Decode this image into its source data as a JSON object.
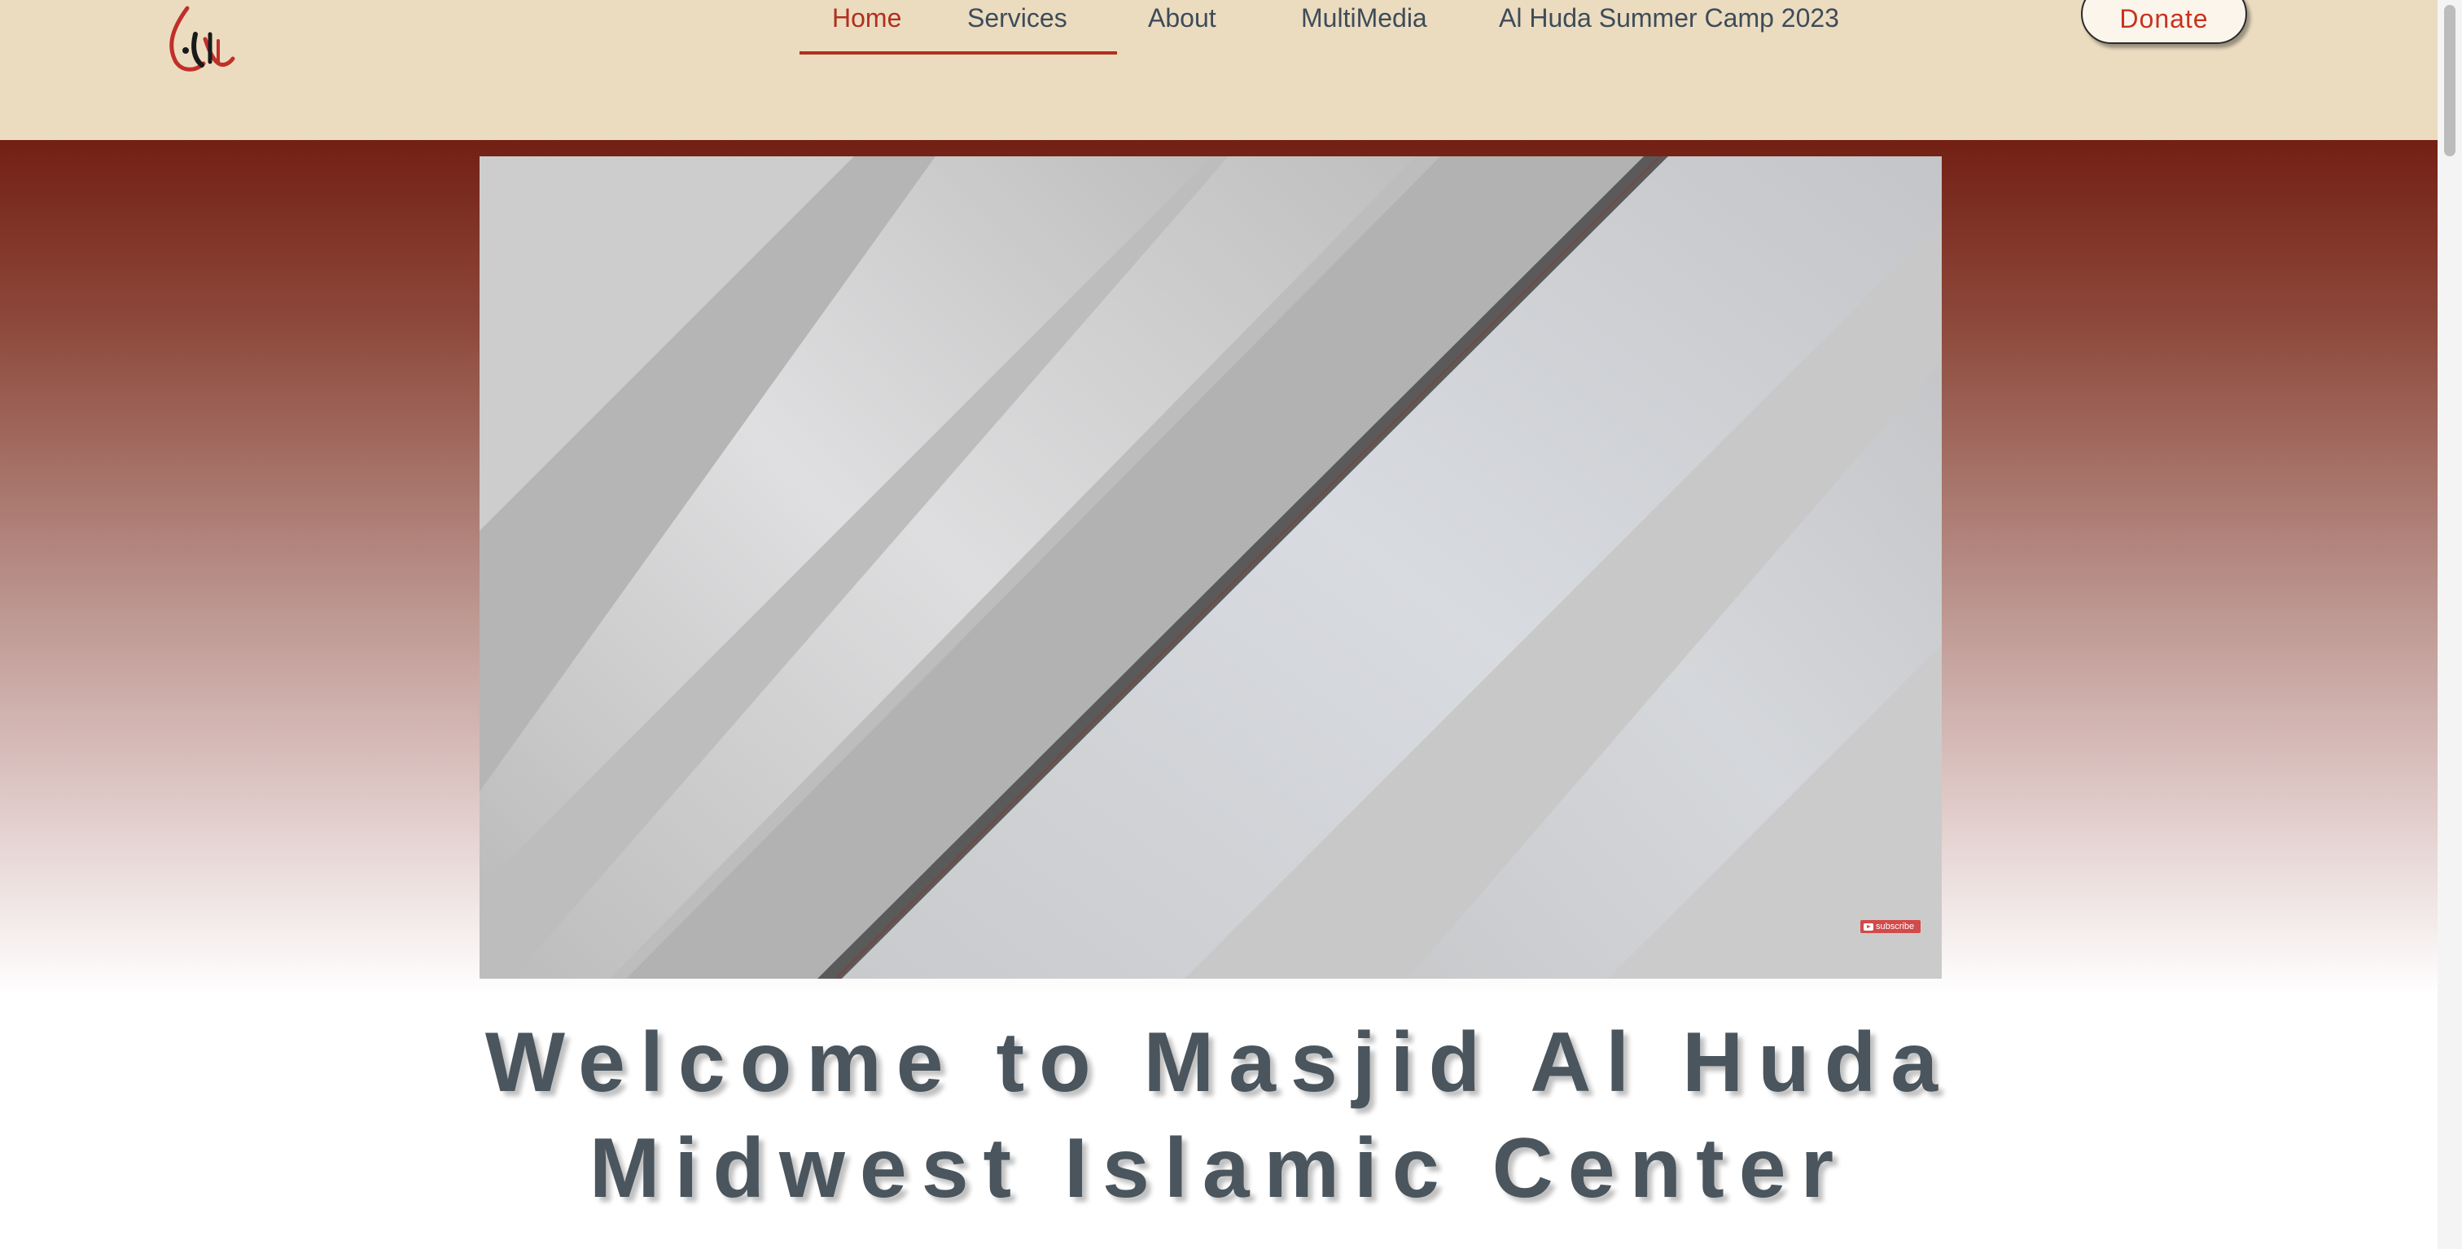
{
  "header": {
    "logo_alt": "هدى",
    "nav": [
      {
        "label": "Home",
        "active": true
      },
      {
        "label": "Services",
        "active": false
      },
      {
        "label": "About",
        "active": false
      },
      {
        "label": "MultiMedia",
        "active": false
      },
      {
        "label": "Al Huda Summer Camp 2023",
        "active": false
      }
    ],
    "donate_label": "Donate"
  },
  "video": {
    "subscribe_label": "subscribe"
  },
  "welcome": {
    "line1": "Welcome to Masjid Al Huda",
    "line2": "Midwest Islamic Center"
  },
  "colors": {
    "header_bg": "#ebdcc0",
    "accent": "#b0301e",
    "hero_top": "#731f14",
    "heading": "#4a555d"
  }
}
